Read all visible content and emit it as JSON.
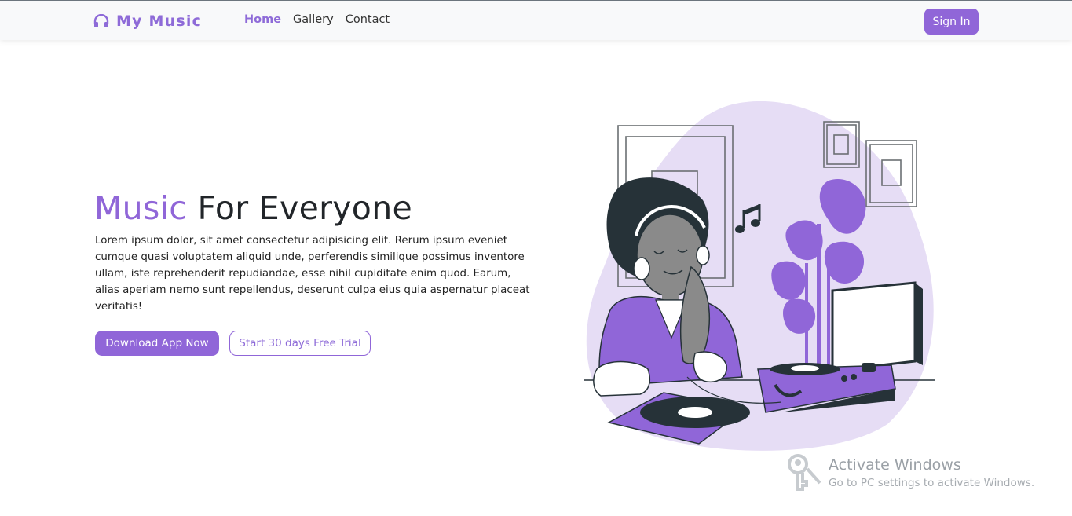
{
  "navbar": {
    "brand": "My Music",
    "links": [
      {
        "label": "Home",
        "active": true
      },
      {
        "label": "Gallery",
        "active": false
      },
      {
        "label": "Contact",
        "active": false
      }
    ],
    "signin_label": "Sign In"
  },
  "hero": {
    "title_accent": "Music",
    "title_rest": "For Everyone",
    "paragraph": "Lorem ipsum dolor, sit amet consectetur adipisicing elit. Rerum ipsum eveniet cumque quasi voluptatem aliquid unde, perferendis similique possimus inventore ullam, iste reprehenderit repudiandae, esse nihil cupiditate enim quod. Earum, alias aperiam nemo sunt repellendus, deserunt culpa eius quia aspernatur placeat veritatis!",
    "primary_button": "Download App Now",
    "secondary_button": "Start 30 days Free Trial"
  },
  "watermark": {
    "title": "Activate Windows",
    "subtitle": "Go to PC settings to activate Windows."
  },
  "colors": {
    "accent": "#9066d8",
    "blob": "#e6ddf5",
    "dark": "#263238",
    "navbar_bg": "#f8f9fa"
  },
  "icons": {
    "brand_icon": "headphones-icon",
    "watermark_icon": "key-icon"
  }
}
